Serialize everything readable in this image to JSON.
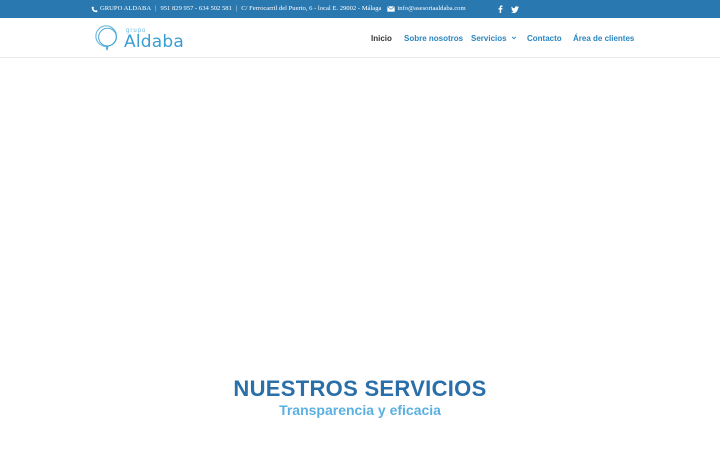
{
  "topbar": {
    "company": "GRUPO ALDABA",
    "phones": "951 829 957 - 634 502 581",
    "address": "C/ Ferrocarril del Puerto, 6 - local E. 29002 - Málaga",
    "email": "info@asesoriaaldaba.com",
    "separator": "|",
    "icons": [
      "phone-icon",
      "mail-icon",
      "facebook-icon",
      "twitter-icon"
    ]
  },
  "logo": {
    "small_text": "grupo",
    "big_text": "Aldaba"
  },
  "nav": {
    "items": [
      {
        "label": "Inicio",
        "active": true
      },
      {
        "label": "Sobre nosotros"
      },
      {
        "label": "Servicios",
        "has_dropdown": true
      },
      {
        "label": "Contacto"
      },
      {
        "label": "Área de clientes"
      }
    ]
  },
  "services": {
    "title": "NUESTROS SERVICIOS",
    "subtitle": "Transparencia y eficacia"
  },
  "colors": {
    "topbar_bg": "#2a78b0",
    "nav_link": "#2a86c0",
    "nav_active": "#333333",
    "title": "#2a6fa8",
    "subtitle": "#5ab0e0"
  }
}
